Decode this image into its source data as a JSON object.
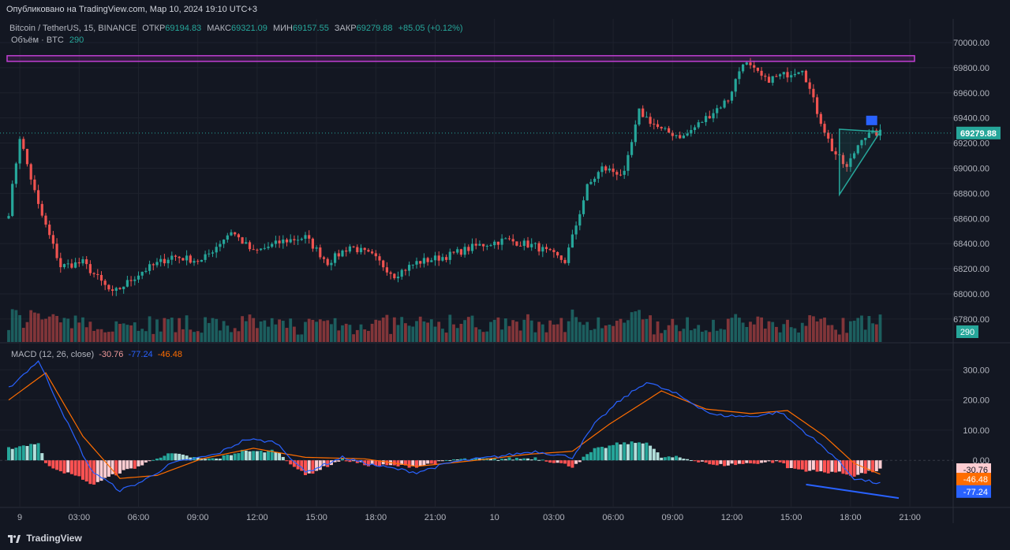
{
  "header": {
    "published": "Опубликовано на TradingView.com, Мар 10, 2024 19:10 UTC+3"
  },
  "legend": {
    "symbol": "Bitcoin / TetherUS, 15, BINANCE",
    "open_label": "ОТКР",
    "open": "69194.83",
    "high_label": "МАКС",
    "high": "69321.09",
    "low_label": "МИН",
    "low": "69157.55",
    "close_label": "ЗАКР",
    "close": "69279.88",
    "change": "+85.05 (+0.12%)",
    "volume_label": "Объём · BTC",
    "volume": "290"
  },
  "macd_legend": {
    "label": "MACD (12, 26, close)",
    "hist": "-30.76",
    "macd": "-77.24",
    "signal": "-46.48"
  },
  "price_axis": {
    "ticks": [
      "70000.00",
      "69800.00",
      "69600.00",
      "69400.00",
      "69200.00",
      "69000.00",
      "68800.00",
      "68600.00",
      "68400.00",
      "68200.00",
      "68000.00",
      "67800.00"
    ],
    "last_price": "69279.88",
    "volume_badge": "290"
  },
  "macd_axis": {
    "ticks": [
      "300.00",
      "200.00",
      "100.00",
      "0.00"
    ],
    "badges": [
      "-30.76",
      "-46.48",
      "-77.24"
    ]
  },
  "time_axis": {
    "labels": [
      "9",
      "03:00",
      "06:00",
      "09:00",
      "12:00",
      "15:00",
      "18:00",
      "21:00",
      "10",
      "03:00",
      "06:00",
      "09:00",
      "12:00",
      "15:00",
      "18:00",
      "21:00"
    ]
  },
  "footer": {
    "brand": "TradingView"
  },
  "colors": {
    "background": "#131722",
    "up": "#26a69a",
    "down": "#ef5350",
    "macd_line": "#2962ff",
    "signal_line": "#ff6d00",
    "resistance": "#c13fd3",
    "triangle": "#26a69a",
    "flag": "#2962ff"
  },
  "chart_data": [
    {
      "type": "candlestick",
      "title": "Bitcoin / TetherUS, 15, BINANCE",
      "ylim": [
        67680,
        70100
      ],
      "x": [
        "9",
        "03:00",
        "06:00",
        "09:00",
        "12:00",
        "15:00",
        "18:00",
        "21:00",
        "10",
        "03:00",
        "06:00",
        "09:00",
        "12:00",
        "15:00",
        "18:00",
        "21:00"
      ],
      "anchors": [
        {
          "i": 0,
          "c": 68650
        },
        {
          "i": 3,
          "c": 69250
        },
        {
          "i": 8,
          "c": 68700
        },
        {
          "i": 14,
          "c": 68220
        },
        {
          "i": 20,
          "c": 68250
        },
        {
          "i": 28,
          "c": 68000
        },
        {
          "i": 36,
          "c": 68180
        },
        {
          "i": 44,
          "c": 68300
        },
        {
          "i": 52,
          "c": 68260
        },
        {
          "i": 60,
          "c": 68500
        },
        {
          "i": 66,
          "c": 68330
        },
        {
          "i": 74,
          "c": 68420
        },
        {
          "i": 80,
          "c": 68450
        },
        {
          "i": 86,
          "c": 68250
        },
        {
          "i": 92,
          "c": 68380
        },
        {
          "i": 98,
          "c": 68300
        },
        {
          "i": 104,
          "c": 68150
        },
        {
          "i": 110,
          "c": 68250
        },
        {
          "i": 118,
          "c": 68300
        },
        {
          "i": 126,
          "c": 68380
        },
        {
          "i": 134,
          "c": 68430
        },
        {
          "i": 142,
          "c": 68380
        },
        {
          "i": 150,
          "c": 68260
        },
        {
          "i": 152,
          "c": 68450
        },
        {
          "i": 156,
          "c": 68850
        },
        {
          "i": 160,
          "c": 69000
        },
        {
          "i": 166,
          "c": 68950
        },
        {
          "i": 170,
          "c": 69450
        },
        {
          "i": 176,
          "c": 69300
        },
        {
          "i": 182,
          "c": 69250
        },
        {
          "i": 188,
          "c": 69400
        },
        {
          "i": 194,
          "c": 69550
        },
        {
          "i": 198,
          "c": 69850
        },
        {
          "i": 204,
          "c": 69700
        },
        {
          "i": 210,
          "c": 69750
        },
        {
          "i": 214,
          "c": 69800
        },
        {
          "i": 218,
          "c": 69450
        },
        {
          "i": 222,
          "c": 69150
        },
        {
          "i": 226,
          "c": 69000
        },
        {
          "i": 230,
          "c": 69250
        },
        {
          "i": 234,
          "c": 69280
        }
      ],
      "resistance_zone": [
        69850,
        69895
      ],
      "triangle": {
        "apex": [
          235,
          69290
        ],
        "top_left": [
          224,
          69310
        ],
        "bottom_left": [
          224,
          68790
        ]
      }
    },
    {
      "type": "bar",
      "title": "Объём · BTC",
      "last": 290
    },
    {
      "type": "macd",
      "title": "MACD (12, 26, close)",
      "ylim": [
        -130,
        340
      ],
      "macd_anchors": [
        {
          "i": 0,
          "v": 240
        },
        {
          "i": 8,
          "v": 330
        },
        {
          "i": 16,
          "v": 120
        },
        {
          "i": 22,
          "v": -30
        },
        {
          "i": 30,
          "v": -100
        },
        {
          "i": 36,
          "v": -70
        },
        {
          "i": 44,
          "v": -10
        },
        {
          "i": 56,
          "v": 20
        },
        {
          "i": 64,
          "v": 70
        },
        {
          "i": 72,
          "v": 60
        },
        {
          "i": 80,
          "v": -40
        },
        {
          "i": 90,
          "v": 10
        },
        {
          "i": 98,
          "v": -15
        },
        {
          "i": 110,
          "v": -40
        },
        {
          "i": 120,
          "v": -5
        },
        {
          "i": 130,
          "v": 10
        },
        {
          "i": 142,
          "v": 30
        },
        {
          "i": 152,
          "v": 10
        },
        {
          "i": 158,
          "v": 120
        },
        {
          "i": 164,
          "v": 190
        },
        {
          "i": 172,
          "v": 260
        },
        {
          "i": 180,
          "v": 220
        },
        {
          "i": 190,
          "v": 150
        },
        {
          "i": 200,
          "v": 145
        },
        {
          "i": 208,
          "v": 160
        },
        {
          "i": 216,
          "v": 80
        },
        {
          "i": 222,
          "v": 20
        },
        {
          "i": 228,
          "v": -60
        },
        {
          "i": 235,
          "v": -77
        }
      ],
      "signal_anchors": [
        {
          "i": 0,
          "v": 200
        },
        {
          "i": 10,
          "v": 290
        },
        {
          "i": 20,
          "v": 80
        },
        {
          "i": 30,
          "v": -60
        },
        {
          "i": 40,
          "v": -50
        },
        {
          "i": 52,
          "v": 5
        },
        {
          "i": 66,
          "v": 40
        },
        {
          "i": 80,
          "v": 10
        },
        {
          "i": 96,
          "v": 5
        },
        {
          "i": 110,
          "v": -20
        },
        {
          "i": 126,
          "v": 0
        },
        {
          "i": 140,
          "v": 20
        },
        {
          "i": 152,
          "v": 30
        },
        {
          "i": 162,
          "v": 120
        },
        {
          "i": 176,
          "v": 230
        },
        {
          "i": 188,
          "v": 170
        },
        {
          "i": 200,
          "v": 155
        },
        {
          "i": 210,
          "v": 165
        },
        {
          "i": 220,
          "v": 80
        },
        {
          "i": 228,
          "v": -10
        },
        {
          "i": 235,
          "v": -46
        }
      ],
      "histogram_last": -30.76
    }
  ]
}
